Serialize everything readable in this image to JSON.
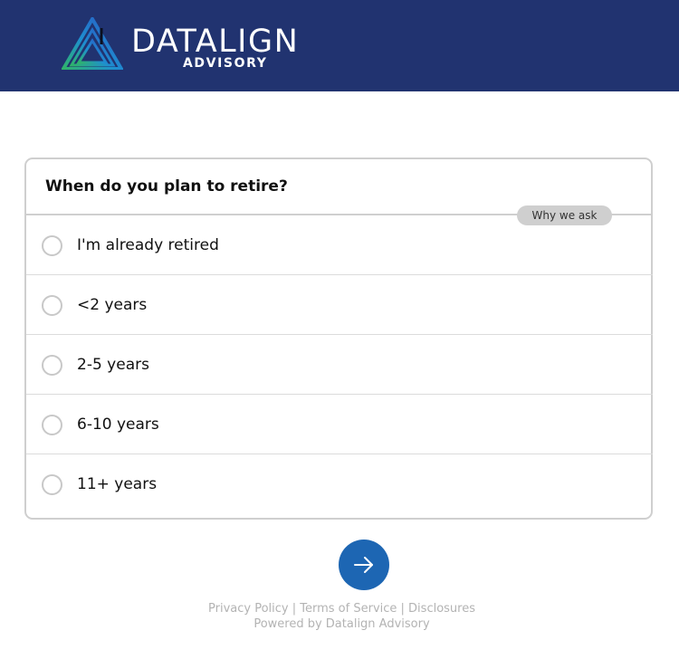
{
  "brand": {
    "name": "DATALIGN",
    "subtitle": "ADVISORY",
    "header_color": "#213370",
    "logo_icon": "triangle-logo-icon"
  },
  "question": {
    "text": "When do you plan to retire?",
    "why_label": "Why we ask"
  },
  "options": [
    {
      "label": "I'm already retired",
      "selected": false
    },
    {
      "label": "<2 years",
      "selected": false
    },
    {
      "label": "2-5 years",
      "selected": false
    },
    {
      "label": "6-10 years",
      "selected": false
    },
    {
      "label": "11+ years",
      "selected": false
    }
  ],
  "next_button": {
    "icon": "arrow-right-icon",
    "color": "#1d66b3"
  },
  "footer": {
    "links": [
      "Privacy Policy",
      "Terms of Service",
      "Disclosures"
    ],
    "separator": " | ",
    "powered_by": "Powered by Datalign Advisory"
  }
}
